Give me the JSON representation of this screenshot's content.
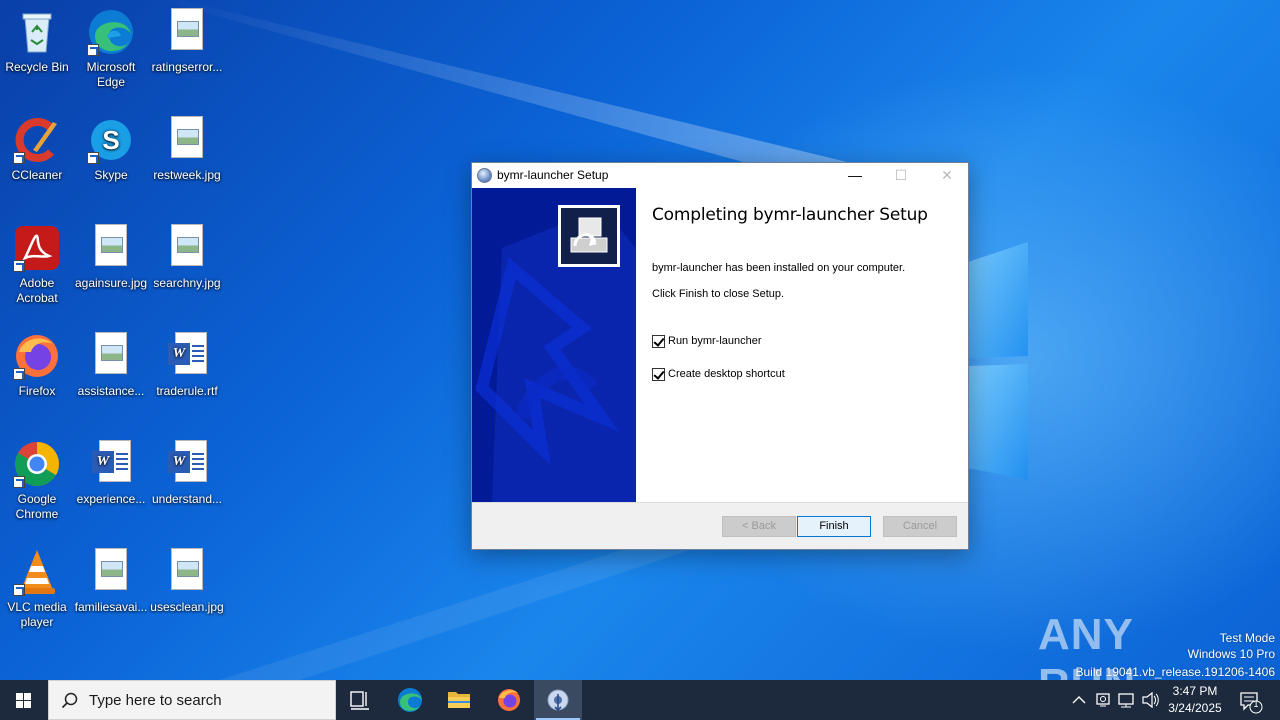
{
  "desktop": {
    "icons": [
      {
        "label": "Recycle Bin"
      },
      {
        "label": "Microsoft Edge"
      },
      {
        "label": "ratingserror..."
      },
      {
        "label": "CCleaner"
      },
      {
        "label": "Skype"
      },
      {
        "label": "restweek.jpg"
      },
      {
        "label": "Adobe Acrobat"
      },
      {
        "label": "againsure.jpg"
      },
      {
        "label": "searchny.jpg"
      },
      {
        "label": "Firefox"
      },
      {
        "label": "assistance..."
      },
      {
        "label": "traderule.rtf"
      },
      {
        "label": "Google Chrome"
      },
      {
        "label": "experience..."
      },
      {
        "label": "understand..."
      },
      {
        "label": "VLC media player"
      },
      {
        "label": "familiesavai..."
      },
      {
        "label": "usesclean.jpg"
      }
    ]
  },
  "dialog": {
    "title": "bymr-launcher Setup",
    "heading": "Completing bymr-launcher Setup",
    "installed_text": "bymr-launcher has been installed on your computer.",
    "close_text": "Click Finish to close Setup.",
    "checkboxes": [
      {
        "label": "Run bymr-launcher",
        "checked": true
      },
      {
        "label": "Create desktop shortcut",
        "checked": true
      }
    ],
    "buttons": {
      "back": "< Back",
      "finish": "Finish",
      "cancel": "Cancel"
    },
    "window_controls": {
      "minimize": "—",
      "maximize": "☐",
      "close": "✕"
    }
  },
  "watermark": {
    "brand": "ANY RUN",
    "mode": "Test Mode",
    "os": "Windows 10 Pro",
    "build": "Build 19041.vb_release.191206-1406"
  },
  "taskbar": {
    "search_placeholder": "Type here to search",
    "clock_time": "3:47 PM",
    "clock_date": "3/24/2025",
    "notification_count": "1"
  },
  "colors": {
    "taskbar_bg": "#1d2a3d",
    "dialog_side_panel": "#001a9e",
    "default_button_border": "#0078d7"
  }
}
